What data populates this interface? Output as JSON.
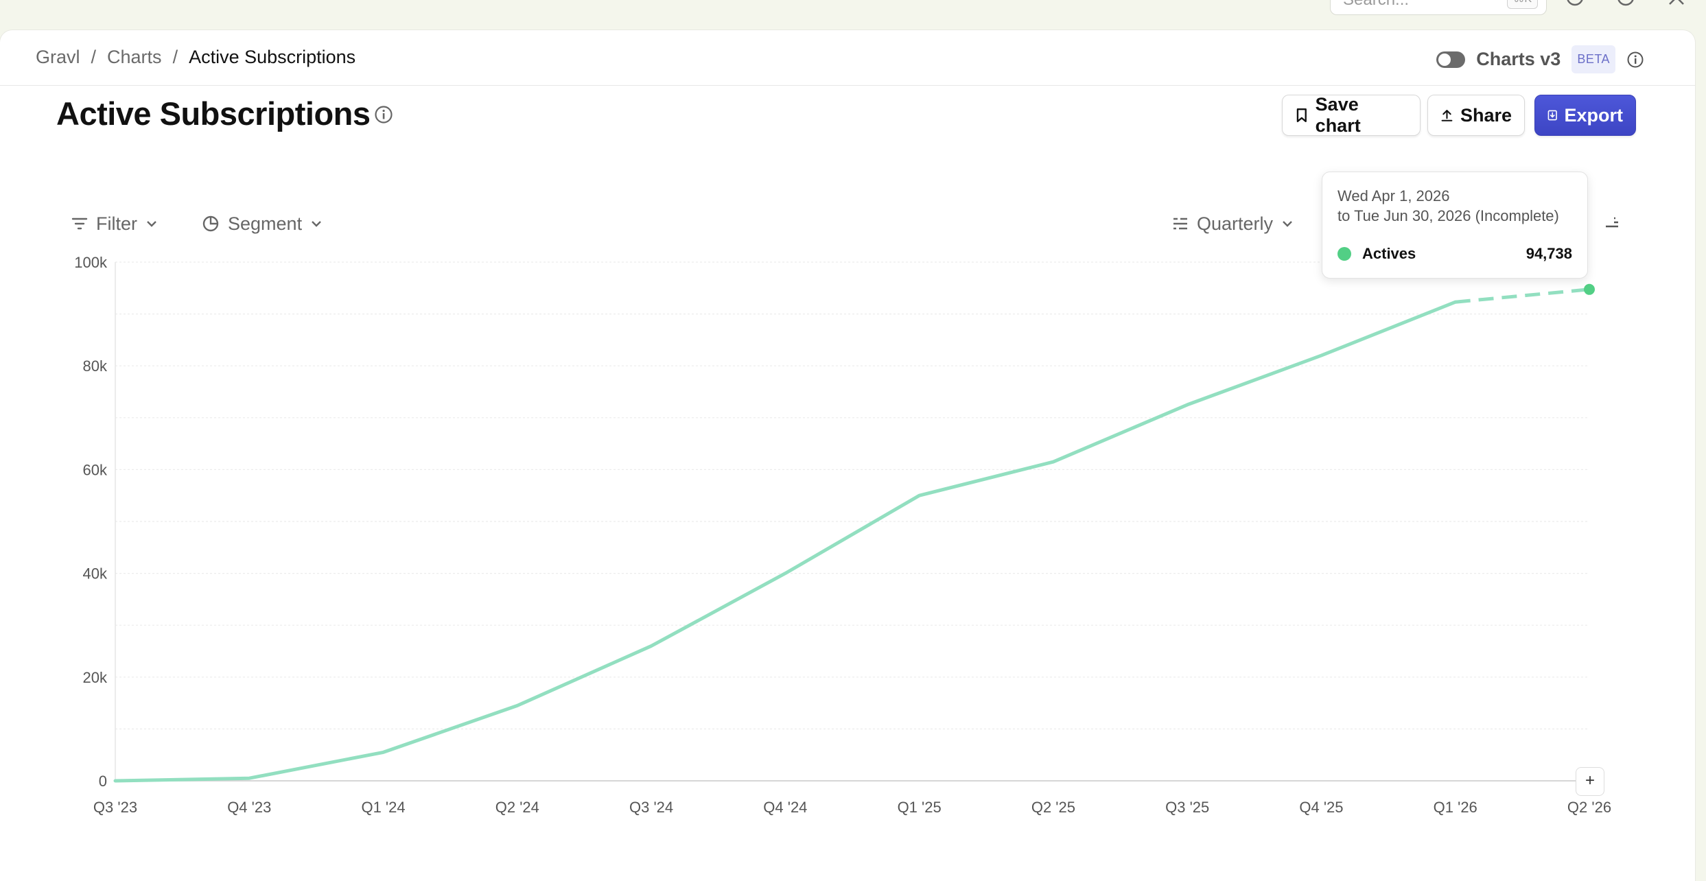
{
  "topbar": {
    "search_placeholder": "Search...",
    "search_shortcut": "⌘K"
  },
  "breadcrumb": {
    "items": [
      "Gravl",
      "Charts",
      "Active Subscriptions"
    ],
    "separator": "/"
  },
  "charts_v3": {
    "label": "Charts v3",
    "badge": "BETA",
    "enabled": false
  },
  "page": {
    "title": "Active Subscriptions"
  },
  "actions": {
    "save_label": "Save chart",
    "share_label": "Share",
    "export_label": "Export"
  },
  "controls": {
    "filter_label": "Filter",
    "segment_label": "Segment",
    "interval_label": "Quarterly"
  },
  "tooltip": {
    "line1": "Wed Apr 1, 2026",
    "line2": "to Tue Jun 30, 2026 (Incomplete)",
    "series_name": "Actives",
    "series_value": "94,738"
  },
  "colors": {
    "series": "#92dfc0",
    "series_dot": "#52cf85",
    "accent": "#4650d3"
  },
  "chart_data": {
    "type": "line",
    "categories": [
      "Q3 '23",
      "Q4 '23",
      "Q1 '24",
      "Q2 '24",
      "Q3 '24",
      "Q4 '24",
      "Q1 '25",
      "Q2 '25",
      "Q3 '25",
      "Q4 '25",
      "Q1 '26",
      "Q2 '26"
    ],
    "series": [
      {
        "name": "Actives",
        "values": [
          0,
          500,
          5500,
          14500,
          26000,
          40000,
          55000,
          61500,
          72500,
          82000,
          92300,
          94738
        ],
        "incomplete_from_index": 10
      }
    ],
    "ylim": [
      0,
      100000
    ],
    "yticks": [
      "0",
      "20k",
      "40k",
      "60k",
      "80k",
      "100k"
    ],
    "grid": true,
    "xlabel": "",
    "ylabel": ""
  }
}
